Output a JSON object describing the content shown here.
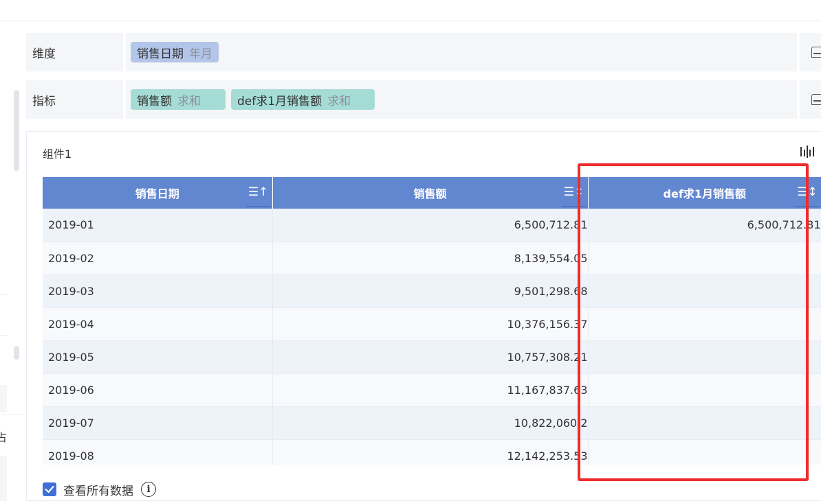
{
  "dimension_row": {
    "label": "维度",
    "chips": [
      {
        "name": "销售日期",
        "agg": "年月"
      }
    ]
  },
  "metric_row": {
    "label": "指标",
    "chips": [
      {
        "name": "销售额",
        "agg": "求和"
      },
      {
        "name": "def求1月销售额",
        "agg": "求和"
      }
    ]
  },
  "component": {
    "title": "组件1"
  },
  "table": {
    "columns": [
      {
        "label": "销售日期",
        "sort_icon": "☰↑"
      },
      {
        "label": "销售额",
        "sort_icon": "☰↕"
      },
      {
        "label": "def求1月销售额",
        "sort_icon": "☰↕"
      }
    ],
    "rows": [
      {
        "date": "2019-01",
        "sales": "6,500,712.81",
        "jan_sales": "6,500,712.81"
      },
      {
        "date": "2019-02",
        "sales": "8,139,554.05",
        "jan_sales": ""
      },
      {
        "date": "2019-03",
        "sales": "9,501,298.68",
        "jan_sales": ""
      },
      {
        "date": "2019-04",
        "sales": "10,376,156.37",
        "jan_sales": ""
      },
      {
        "date": "2019-05",
        "sales": "10,757,308.21",
        "jan_sales": ""
      },
      {
        "date": "2019-06",
        "sales": "11,167,837.63",
        "jan_sales": ""
      },
      {
        "date": "2019-07",
        "sales": "10,822,060.2",
        "jan_sales": ""
      },
      {
        "date": "2019-08",
        "sales": "12,142,253.53",
        "jan_sales": ""
      }
    ]
  },
  "footer": {
    "view_all_label": "查看所有数据",
    "view_all_checked": true,
    "info_glyph": "i"
  },
  "left_panel": {
    "glyph": "占"
  },
  "colors": {
    "header_bg": "#6287d1",
    "dimension_chip": "#b3c5e8",
    "measure_chip": "#a6dcd6",
    "highlight": "#ee2c2c",
    "checkbox": "#3f6fd9"
  }
}
